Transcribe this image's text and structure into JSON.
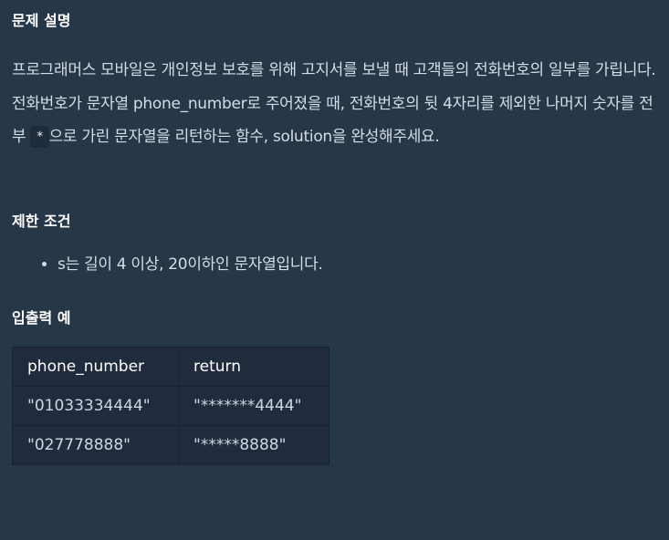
{
  "sections": {
    "problem_title": "문제 설명",
    "constraints_title": "제한 조건",
    "io_title": "입출력 예"
  },
  "description": {
    "p1": "프로그래머스 모바일은 개인정보 보호를 위해 고지서를 보낼 때 고객들의 전화번호의 일부를 가립니다.",
    "p2_before": "전화번호가 문자열 phone_number로 주어졌을 때, 전화번호의 뒷 4자리를 제외한 나머지 숫자를 전부 ",
    "p2_code": "*",
    "p2_after": "으로 가린 문자열을 리턴하는 함수, solution을 완성해주세요."
  },
  "constraints": [
    "s는 길이 4 이상, 20이하인 문자열입니다."
  ],
  "io_table": {
    "headers": [
      "phone_number",
      "return"
    ],
    "rows": [
      [
        "\"01033334444\"",
        "\"*******4444\""
      ],
      [
        "\"027778888\"",
        "\"*****8888\""
      ]
    ]
  }
}
